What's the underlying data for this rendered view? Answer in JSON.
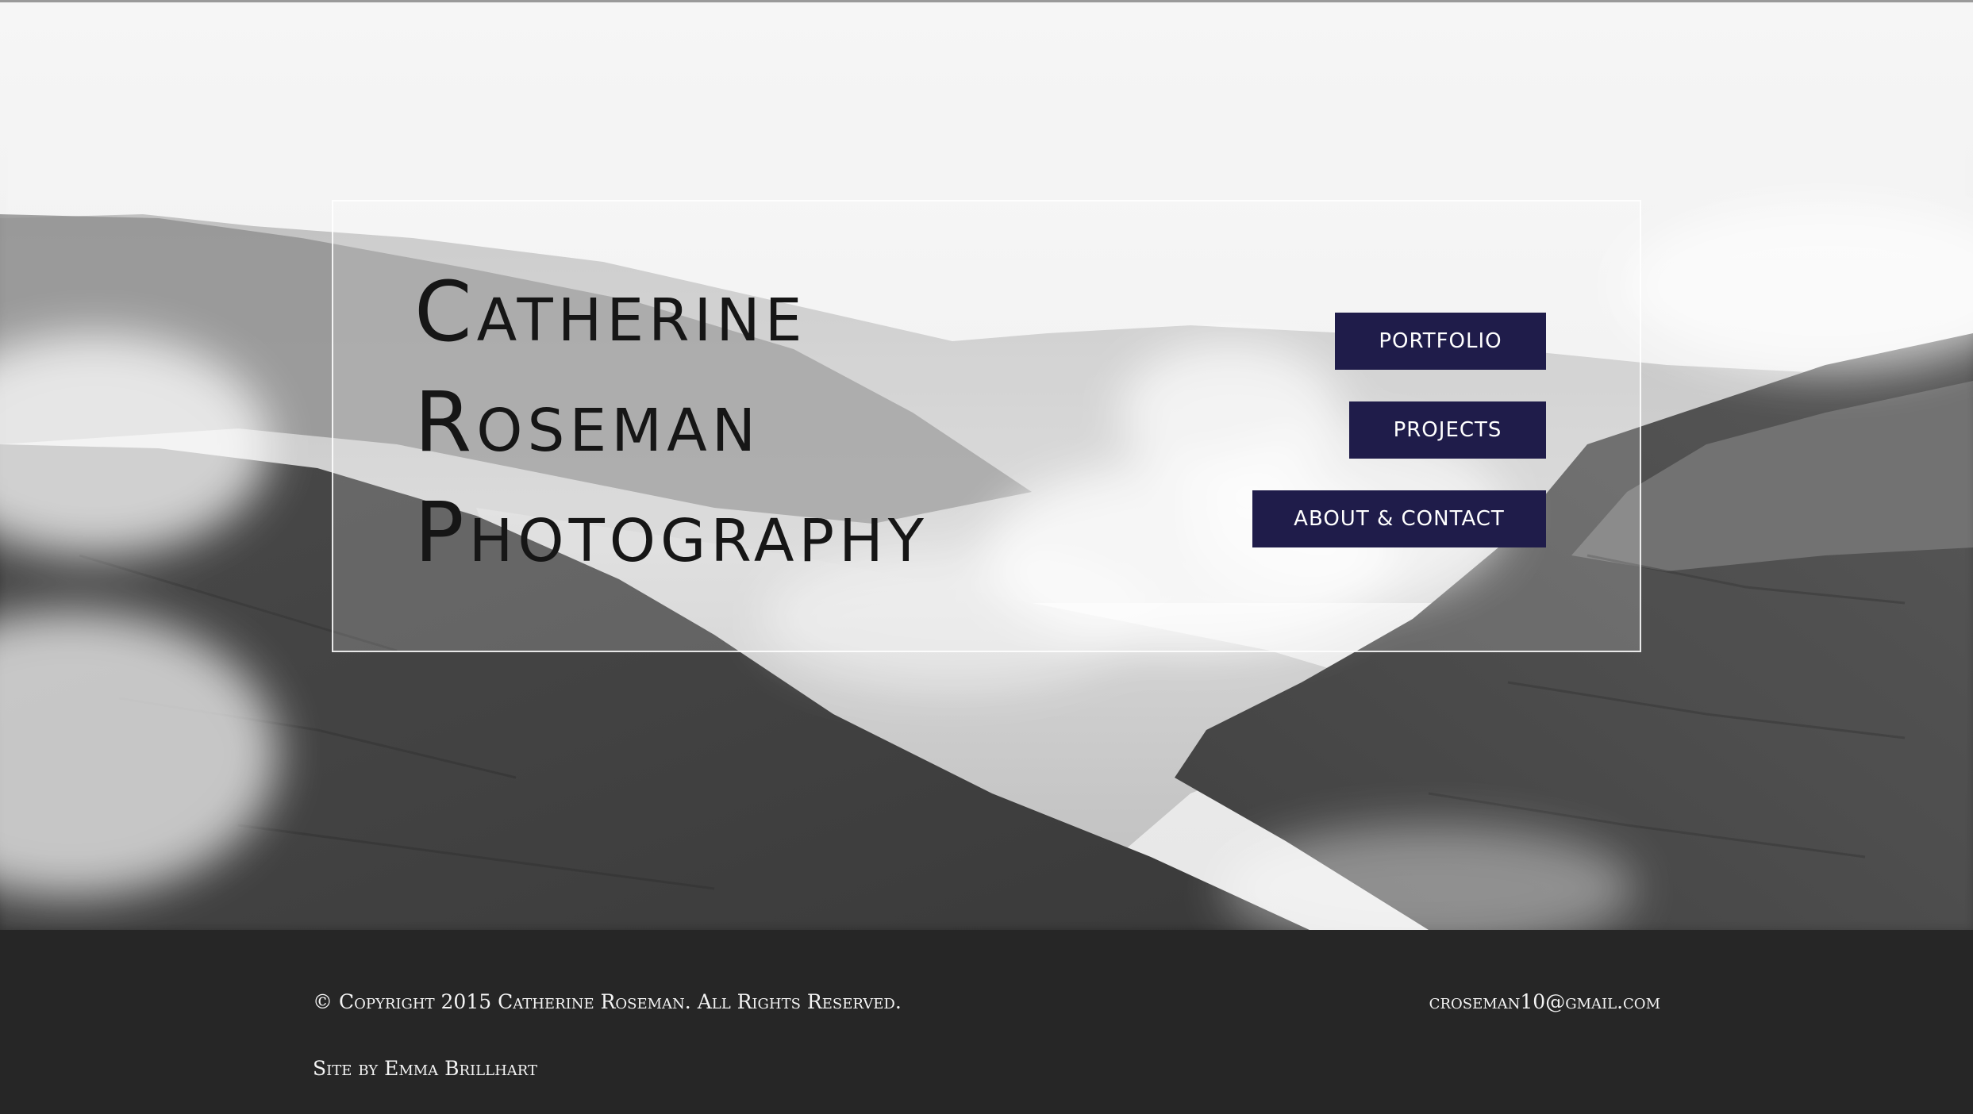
{
  "site": {
    "title_lines": [
      {
        "initial": "C",
        "rest": "atherine"
      },
      {
        "initial": "R",
        "rest": "oseman"
      },
      {
        "initial": "P",
        "rest": "hotography"
      }
    ]
  },
  "nav": {
    "portfolio_label": "Portfolio",
    "projects_label": "Projects",
    "about_contact_label": "About & Contact"
  },
  "footer": {
    "copyright": "© Copyright 2015 Catherine Roseman. All Rights Reserved.",
    "credit": "Site by Emma Brillhart",
    "email": "croseman10@gmail.com"
  },
  "colors": {
    "nav_button_bg": "#1f1c4a",
    "footer_bg": "#262626"
  },
  "images": {
    "hero": "black-and-white-mountain-valley-photo"
  }
}
